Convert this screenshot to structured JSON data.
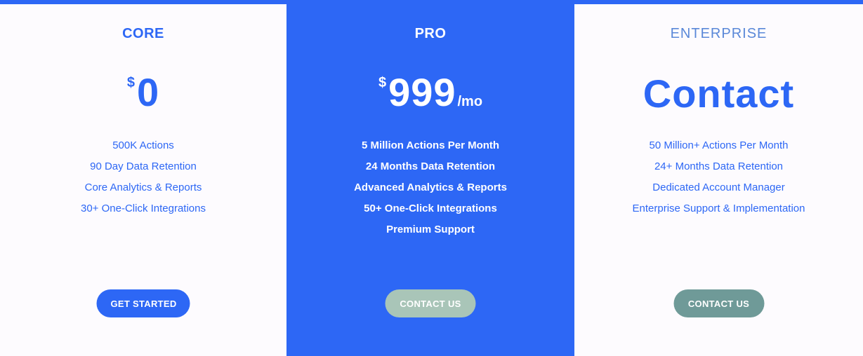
{
  "plans": [
    {
      "name": "CORE",
      "currency": "$",
      "amount": "0",
      "period": "",
      "features": [
        "500K Actions",
        "90 Day Data Retention",
        "Core Analytics & Reports",
        "30+ One-Click Integrations"
      ],
      "cta": "GET STARTED"
    },
    {
      "name": "PRO",
      "currency": "$",
      "amount": "999",
      "period": "/mo",
      "features": [
        "5 Million Actions Per Month",
        "24 Months Data Retention",
        "Advanced Analytics & Reports",
        "50+ One-Click Integrations",
        "Premium Support"
      ],
      "cta": "CONTACT US"
    },
    {
      "name": "ENTERPRISE",
      "currency": "",
      "amount": "Contact",
      "period": "",
      "features": [
        "50 Million+ Actions Per Month",
        "24+ Months Data Retention",
        "Dedicated Account Manager",
        "Enterprise Support & Implementation"
      ],
      "cta": "CONTACT US"
    }
  ],
  "colors": {
    "accent": "#2d67f5",
    "background": "#fdfbfe",
    "pro_button": "#a9c5b8",
    "enterprise_button": "#6f9a98"
  }
}
